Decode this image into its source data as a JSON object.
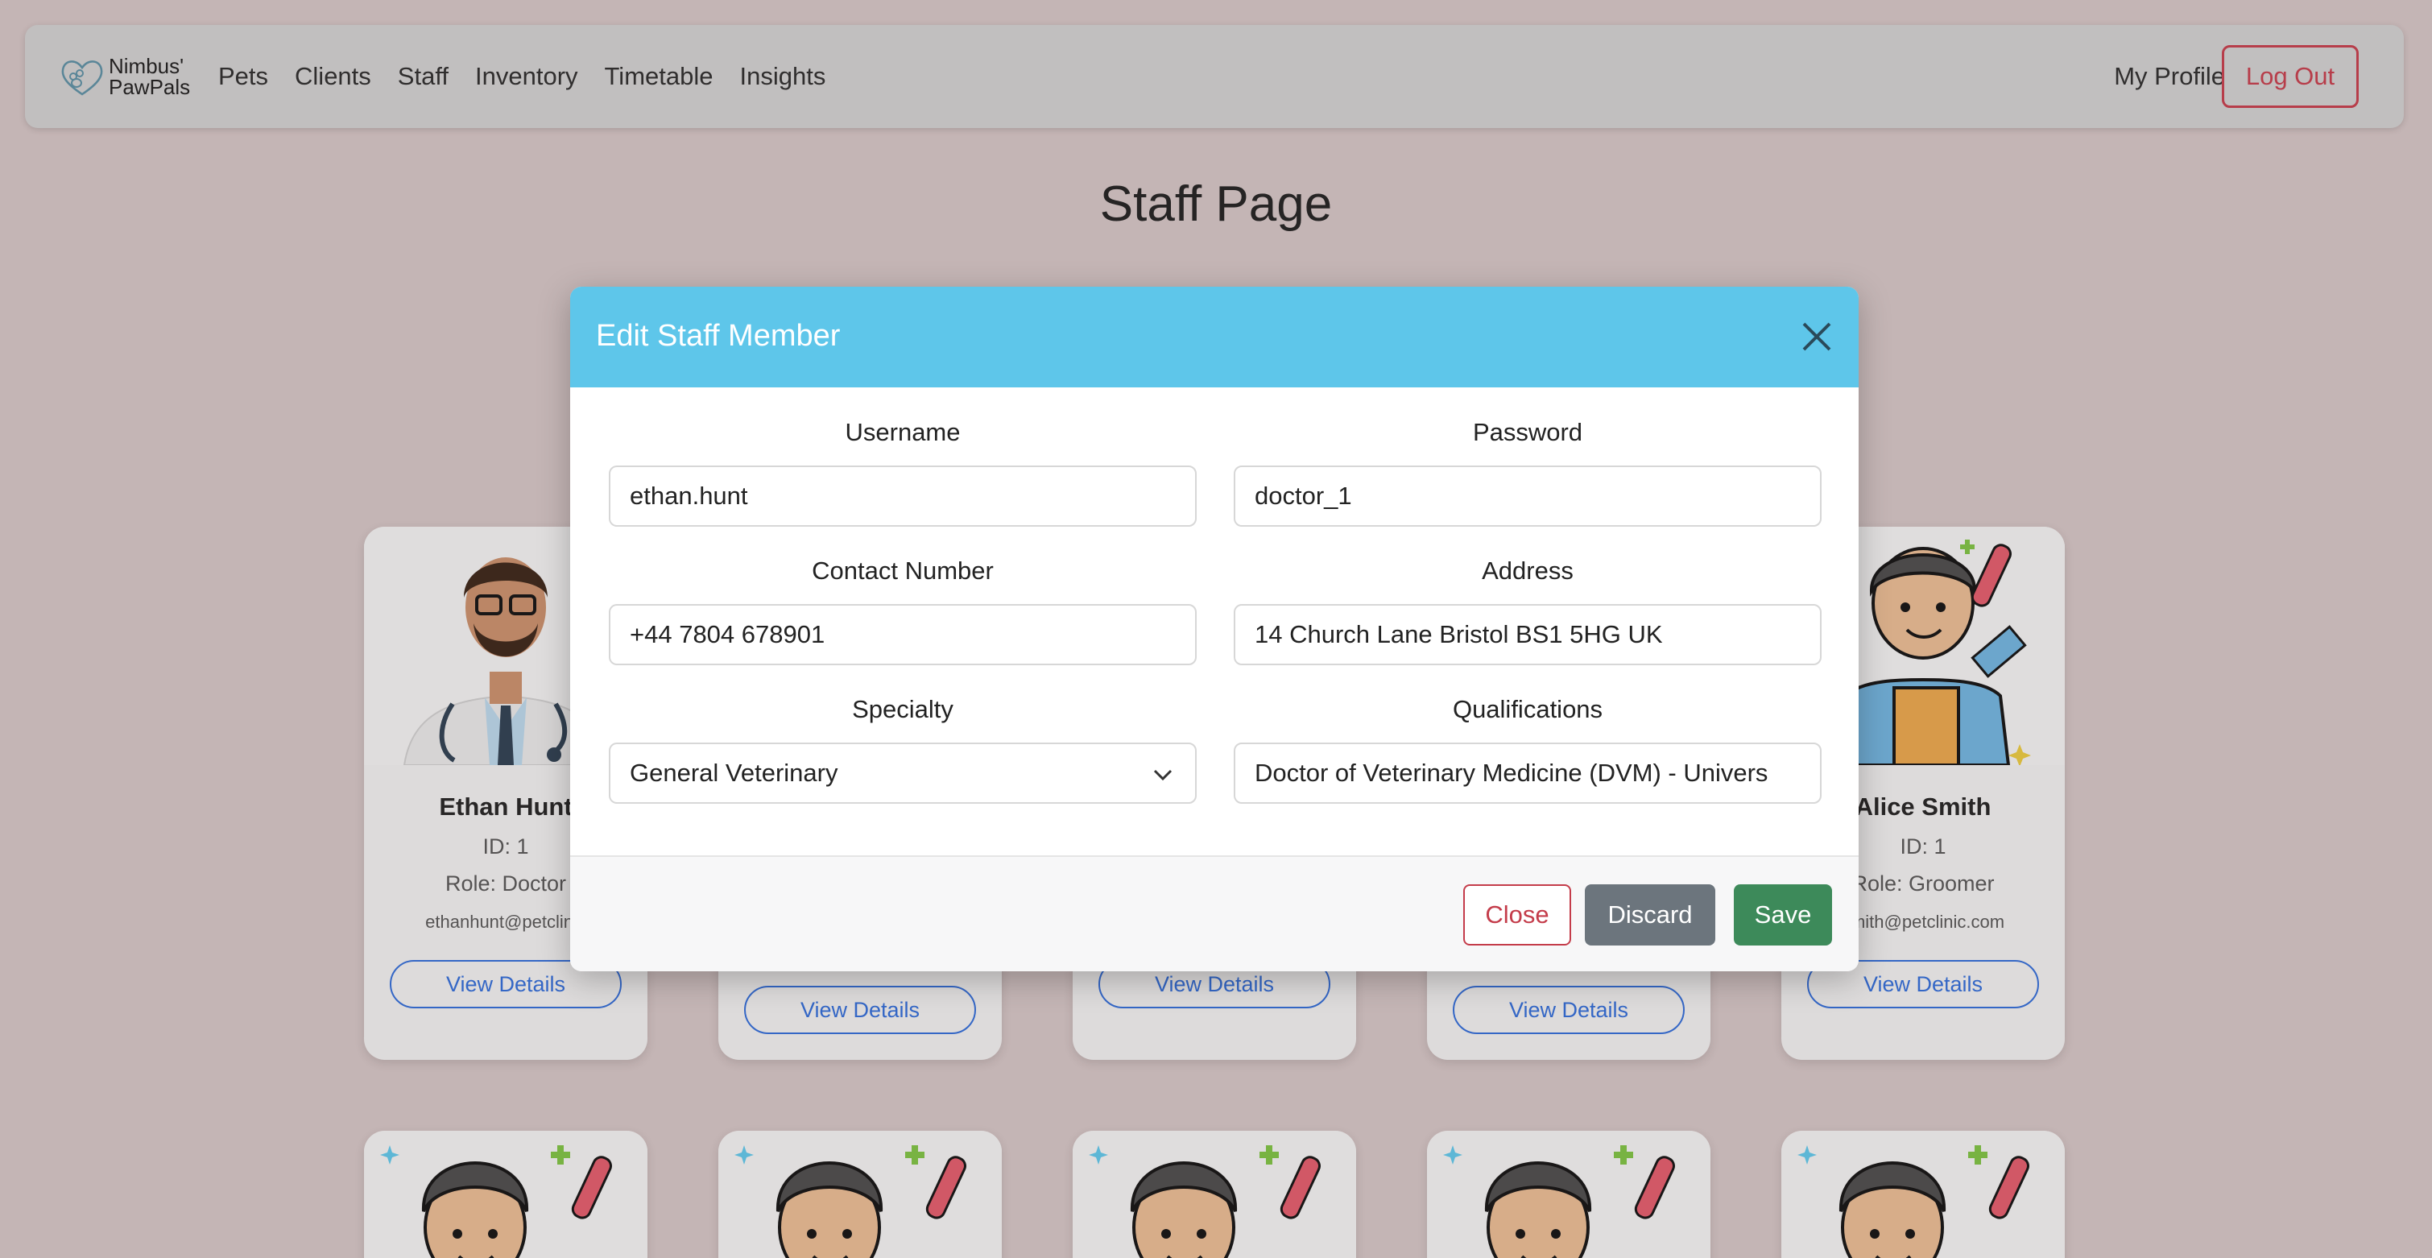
{
  "nav": {
    "brand_line1": "Nimbus'",
    "brand_line2": "PawPals",
    "links": [
      "Pets",
      "Clients",
      "Staff",
      "Inventory",
      "Timetable",
      "Insights"
    ],
    "my_profile": "My Profile",
    "logout": "Log Out"
  },
  "page": {
    "title": "Staff Page"
  },
  "cards": [
    {
      "name": "Ethan Hunt",
      "id": "ID: 1",
      "role": "Role: Doctor",
      "email": "ethanhunt@petclinic",
      "button": "View Details"
    },
    {
      "button": "View Details"
    },
    {
      "button": "View Details"
    },
    {
      "button": "View Details"
    },
    {
      "name": "Alice Smith",
      "id": "ID: 1",
      "role": "Role: Groomer",
      "email": "smith@petclinic.com",
      "button": "View Details"
    }
  ],
  "modal": {
    "title": "Edit Staff Member",
    "fields": {
      "username": {
        "label": "Username",
        "value": "ethan.hunt"
      },
      "password": {
        "label": "Password",
        "value": "doctor_1"
      },
      "contact": {
        "label": "Contact Number",
        "value": "+44 7804 678901"
      },
      "address": {
        "label": "Address",
        "value": "14 Church Lane Bristol BS1 5HG UK"
      },
      "specialty": {
        "label": "Specialty",
        "value": "General Veterinary"
      },
      "qualifications": {
        "label": "Qualifications",
        "value": "Doctor of Veterinary Medicine (DVM) - Univers"
      }
    },
    "buttons": {
      "close": "Close",
      "discard": "Discard",
      "save": "Save"
    }
  },
  "colors": {
    "background": "#d3c4c4",
    "navbar": "#d0d0d0",
    "modal_header": "#5ec6ea",
    "danger": "#c43c4a",
    "primary": "#2f6bd8",
    "secondary": "#6c757d",
    "success": "#3d8a5a"
  }
}
